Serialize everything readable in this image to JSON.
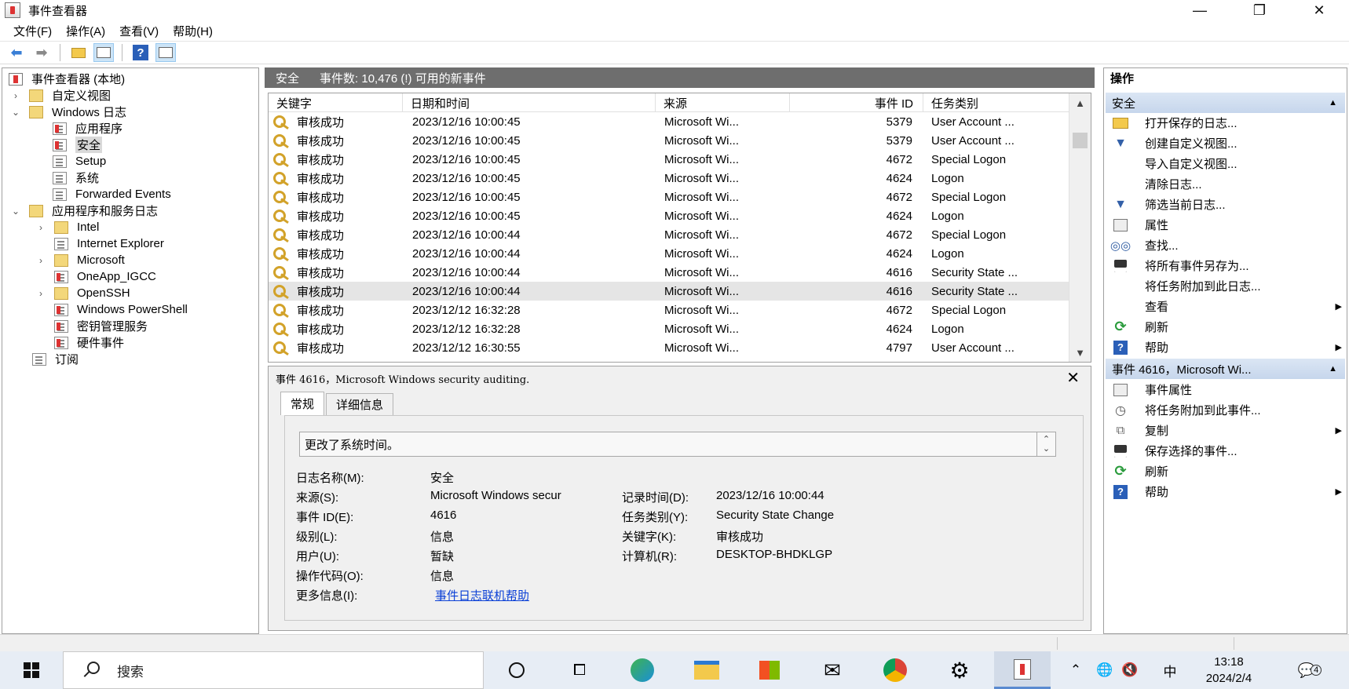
{
  "window": {
    "title": "事件查看器",
    "minimize": "—",
    "restore": "❐",
    "close": "✕"
  },
  "menu": [
    "文件(F)",
    "操作(A)",
    "查看(V)",
    "帮助(H)"
  ],
  "toolbar": {
    "back_icon": "arrow-left",
    "forward_icon": "arrow-right",
    "icons": [
      "folder-up",
      "show-hide-tree",
      "help",
      "show-hide-actions"
    ]
  },
  "tree": {
    "root": "事件查看器 (本地)",
    "custom_views": "自定义视图",
    "windows_logs": "Windows 日志",
    "app": "应用程序",
    "security": "安全",
    "setup": "Setup",
    "system": "系统",
    "forwarded": "Forwarded Events",
    "apps_services": "应用程序和服务日志",
    "intel": "Intel",
    "ie": "Internet Explorer",
    "microsoft": "Microsoft",
    "oneapp": "OneApp_IGCC",
    "openssh": "OpenSSH",
    "powershell": "Windows PowerShell",
    "keymgmt": "密钥管理服务",
    "hardware": "硬件事件",
    "subscriptions": "订阅"
  },
  "center": {
    "title": "安全",
    "summary": "事件数: 10,476 (!) 可用的新事件"
  },
  "events": {
    "columns": [
      "关键字",
      "日期和时间",
      "来源",
      "事件 ID",
      "任务类别"
    ],
    "rows": [
      {
        "keyword": "审核成功",
        "datetime": "2023/12/16 10:00:45",
        "source": "Microsoft Wi...",
        "id": "5379",
        "task": "User Account ..."
      },
      {
        "keyword": "审核成功",
        "datetime": "2023/12/16 10:00:45",
        "source": "Microsoft Wi...",
        "id": "5379",
        "task": "User Account ..."
      },
      {
        "keyword": "审核成功",
        "datetime": "2023/12/16 10:00:45",
        "source": "Microsoft Wi...",
        "id": "4672",
        "task": "Special Logon"
      },
      {
        "keyword": "审核成功",
        "datetime": "2023/12/16 10:00:45",
        "source": "Microsoft Wi...",
        "id": "4624",
        "task": "Logon"
      },
      {
        "keyword": "审核成功",
        "datetime": "2023/12/16 10:00:45",
        "source": "Microsoft Wi...",
        "id": "4672",
        "task": "Special Logon"
      },
      {
        "keyword": "审核成功",
        "datetime": "2023/12/16 10:00:45",
        "source": "Microsoft Wi...",
        "id": "4624",
        "task": "Logon"
      },
      {
        "keyword": "审核成功",
        "datetime": "2023/12/16 10:00:44",
        "source": "Microsoft Wi...",
        "id": "4672",
        "task": "Special Logon"
      },
      {
        "keyword": "审核成功",
        "datetime": "2023/12/16 10:00:44",
        "source": "Microsoft Wi...",
        "id": "4624",
        "task": "Logon"
      },
      {
        "keyword": "审核成功",
        "datetime": "2023/12/16 10:00:44",
        "source": "Microsoft Wi...",
        "id": "4616",
        "task": "Security State ..."
      },
      {
        "keyword": "审核成功",
        "datetime": "2023/12/16 10:00:44",
        "source": "Microsoft Wi...",
        "id": "4616",
        "task": "Security State ...",
        "selected": true
      },
      {
        "keyword": "审核成功",
        "datetime": "2023/12/12 16:32:28",
        "source": "Microsoft Wi...",
        "id": "4672",
        "task": "Special Logon"
      },
      {
        "keyword": "审核成功",
        "datetime": "2023/12/12 16:32:28",
        "source": "Microsoft Wi...",
        "id": "4624",
        "task": "Logon"
      },
      {
        "keyword": "审核成功",
        "datetime": "2023/12/12 16:30:55",
        "source": "Microsoft Wi...",
        "id": "4797",
        "task": "User Account ..."
      }
    ]
  },
  "detail": {
    "title": "事件 4616，Microsoft Windows security auditing.",
    "close": "✕",
    "tab_general": "常规",
    "tab_details": "详细信息",
    "description": "更改了系统时间。",
    "log_name_label": "日志名称(M):",
    "log_name": "安全",
    "source_label": "来源(S):",
    "source": "Microsoft Windows secur",
    "logged_label": "记录时间(D):",
    "logged": "2023/12/16 10:00:44",
    "event_id_label": "事件 ID(E):",
    "event_id": "4616",
    "task_label": "任务类别(Y):",
    "task": "Security State Change",
    "level_label": "级别(L):",
    "level": "信息",
    "keywords_label": "关键字(K):",
    "keywords": "审核成功",
    "user_label": "用户(U):",
    "user": "暂缺",
    "computer_label": "计算机(R):",
    "computer": "DESKTOP-BHDKLGP",
    "opcode_label": "操作代码(O):",
    "opcode": "信息",
    "more_info_label": "更多信息(I):",
    "more_info_link": "事件日志联机帮助"
  },
  "actions": {
    "title": "操作",
    "section1": "安全",
    "open_saved": "打开保存的日志...",
    "create_view": "创建自定义视图...",
    "import_view": "导入自定义视图...",
    "clear_log": "清除日志...",
    "filter": "筛选当前日志...",
    "properties": "属性",
    "find": "查找...",
    "save_all": "将所有事件另存为...",
    "attach_task_log": "将任务附加到此日志...",
    "view": "查看",
    "refresh": "刷新",
    "help": "帮助",
    "section2": "事件 4616，Microsoft Wi...",
    "event_props": "事件属性",
    "attach_task_event": "将任务附加到此事件...",
    "copy": "复制",
    "save_selected": "保存选择的事件...",
    "refresh2": "刷新",
    "help2": "帮助"
  },
  "taskbar": {
    "search_placeholder": "搜索",
    "time": "13:18",
    "date": "2024/2/4",
    "ime": "中",
    "notifications": "4"
  }
}
